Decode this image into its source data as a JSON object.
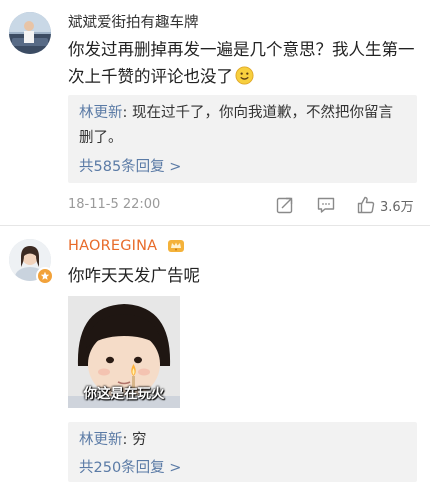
{
  "comments": [
    {
      "username": "斌斌爱街拍有趣车牌",
      "text": "你发过再删掉再发一遍是几个意思？我人生第一次上千赞的评论也没了",
      "reply": {
        "name": "林更新",
        "sep": ": ",
        "text": "现在过千了，你向我道歉，不然把你留言删了。"
      },
      "more_replies": "共585条回复 >",
      "timestamp": "18-11-5 22:00",
      "like_count": "3.6万",
      "icons": [
        "share-icon",
        "comment-icon",
        "like-icon"
      ]
    },
    {
      "username": "HAOREGINA",
      "text": "你咋天天发广告呢",
      "sticker_caption": "你这是在玩火",
      "reply": {
        "name": "林更新",
        "sep": ": ",
        "text": "穷"
      },
      "more_replies": "共250条回复 >"
    }
  ],
  "colors": {
    "link": "#5b7ba6",
    "username_highlight": "#e86b2a",
    "reply_bg": "#f2f2f2"
  }
}
